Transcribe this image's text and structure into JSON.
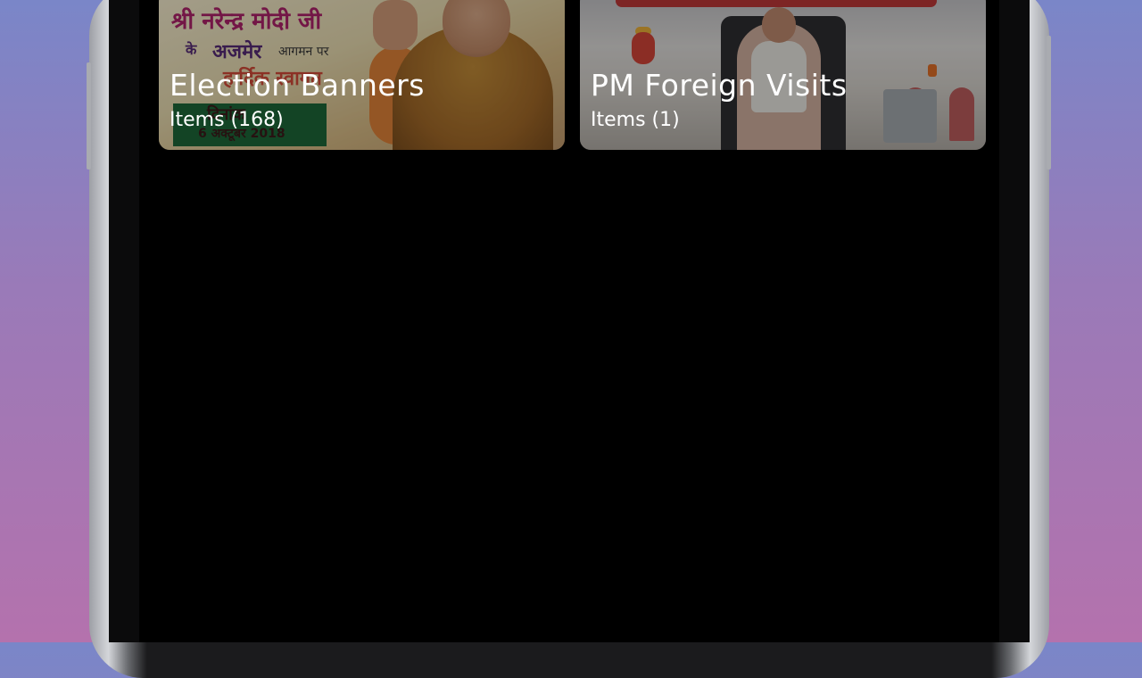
{
  "categories": [
    {
      "title": "Election Banners",
      "count_text": "Items (168)",
      "photo_text": {
        "line1": "श्री नरेन्द्र मोदी जी",
        "line2": "के",
        "line3": "अजमेर",
        "line4": "आगमन पर",
        "line5": "हार्दिक स्वागत",
        "line6": "दिनांक",
        "line7": "6 अक्टूबर 2018"
      }
    },
    {
      "title": "PM Foreign Visits",
      "count_text": "Items (1)"
    }
  ],
  "colors": {
    "screen_background": "#000000",
    "card_text": "#ffffff",
    "background_gradient_top": "#7a86c8",
    "background_gradient_bottom": "#b472ad"
  }
}
